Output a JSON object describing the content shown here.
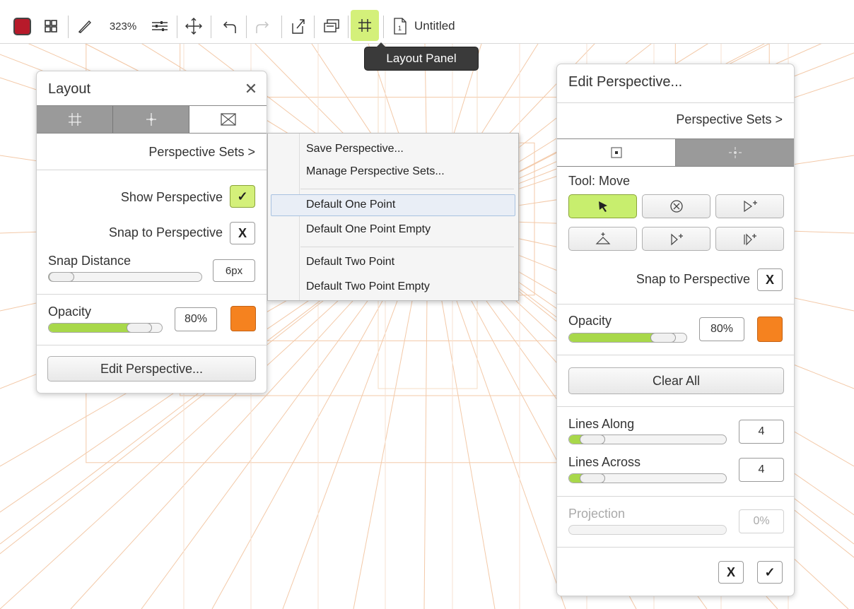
{
  "toolbar": {
    "current_color": "#b71a2a",
    "zoom": "323%",
    "doc_title": "Untitled",
    "tooltip": "Layout Panel",
    "icons": [
      "color-swatch",
      "gallery-icon",
      "brush-icon",
      "zoom-label",
      "adjust-icon",
      "transform-icon",
      "undo-icon",
      "redo-icon",
      "share-icon",
      "layers-icon",
      "grid-icon",
      "document-icon"
    ]
  },
  "layout_panel": {
    "title": "Layout",
    "tabs": [
      "grid-tab",
      "symmetry-tab",
      "perspective-tab"
    ],
    "perspective_sets": "Perspective Sets >",
    "show_perspective": "Show Perspective",
    "show_perspective_value": "✓",
    "snap_to_perspective": "Snap to Perspective",
    "snap_value": "X",
    "snap_distance_label": "Snap Distance",
    "snap_distance_value": "6px",
    "snap_distance_level": 0.05,
    "opacity_label": "Opacity",
    "opacity_value": "80%",
    "opacity_level": 0.8,
    "perspective_color": "#f5821f",
    "edit_button": "Edit Perspective..."
  },
  "menu": {
    "items": [
      "Save Perspective...",
      "Manage Perspective Sets...",
      "Default One Point",
      "Default One Point Empty",
      "Default Two Point",
      "Default Two Point Empty"
    ],
    "selected": "Default One Point"
  },
  "edit_panel": {
    "title": "Edit Perspective...",
    "perspective_sets": "Perspective Sets >",
    "tool_label": "Tool: Move",
    "tools": [
      "move-tool",
      "delete-tool",
      "add-vanishing-point-tool",
      "add-horizon-tool",
      "add-point-tool",
      "add-parallel-point-tool"
    ],
    "snap_to_perspective": "Snap to Perspective",
    "snap_value": "X",
    "opacity_label": "Opacity",
    "opacity_value": "80%",
    "opacity_level": 0.8,
    "perspective_color": "#f5821f",
    "clear_all": "Clear All",
    "lines_along_label": "Lines Along",
    "lines_along_value": "4",
    "lines_along_level": 0.15,
    "lines_across_label": "Lines Across",
    "lines_across_value": "4",
    "lines_across_level": 0.15,
    "projection_label": "Projection",
    "projection_value": "0%",
    "projection_level": 0,
    "cancel": "X",
    "confirm": "✓"
  }
}
